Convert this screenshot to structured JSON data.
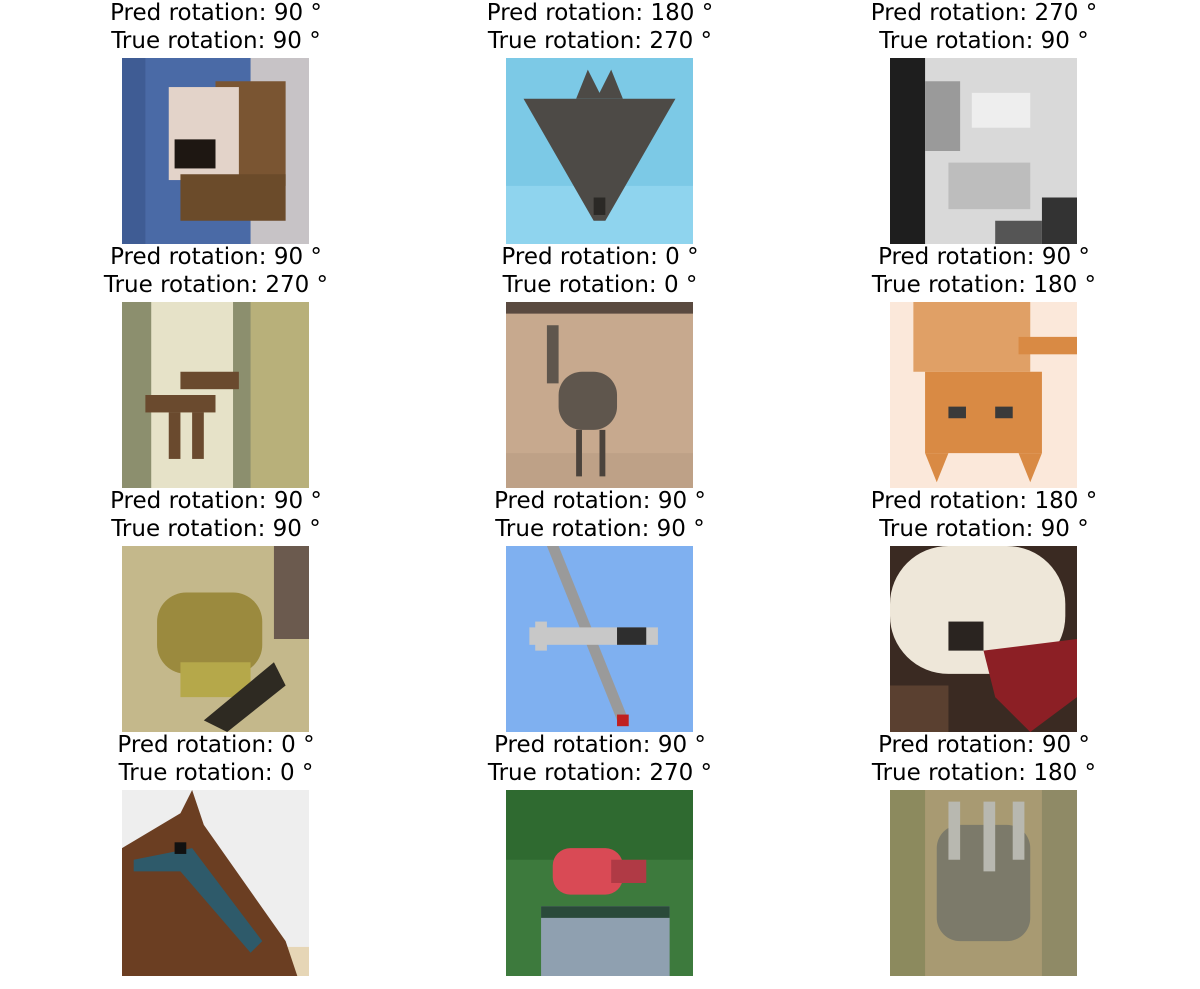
{
  "panels": [
    {
      "pred": "Pred rotation: 90$^\\circ$",
      "true": "True rotation: 90$^\\circ$",
      "pred_text": "Pred rotation: 90 °",
      "true_text": "True rotation: 90 °",
      "subject": "dog-rotated",
      "colors": [
        "#4a6aa6",
        "#c9b8a6",
        "#6b4b2a"
      ]
    },
    {
      "pred_text": "Pred rotation: 180 °",
      "true_text": "True rotation: 270 °",
      "subject": "airplane-stealth",
      "colors": [
        "#7cc9e6",
        "#4d4a46"
      ]
    },
    {
      "pred_text": "Pred rotation: 270 °",
      "true_text": "True rotation: 90 °",
      "subject": "cat-grayscale",
      "colors": [
        "#1e1e1e",
        "#d9d9d9"
      ]
    },
    {
      "pred_text": "Pred rotation: 90 °",
      "true_text": "True rotation: 270 °",
      "subject": "deer-rotated",
      "colors": [
        "#8c8f6e",
        "#e6e2c8",
        "#6a4a2e"
      ]
    },
    {
      "pred_text": "Pred rotation: 0 °",
      "true_text": "True rotation: 0 °",
      "subject": "ostrich",
      "colors": [
        "#c7a98e",
        "#5f564d"
      ]
    },
    {
      "pred_text": "Pred rotation: 90 °",
      "true_text": "True rotation: 180 °",
      "subject": "cat-upside-down",
      "colors": [
        "#fbe8da",
        "#d98a44"
      ]
    },
    {
      "pred_text": "Pred rotation: 90 °",
      "true_text": "True rotation: 90 °",
      "subject": "frog-rotated",
      "colors": [
        "#c4b88b",
        "#9b8a3e",
        "#2e2a22"
      ]
    },
    {
      "pred_text": "Pred rotation: 90 °",
      "true_text": "True rotation: 90 °",
      "subject": "airplane-propeller",
      "colors": [
        "#7fb0f0",
        "#c8c8c8"
      ]
    },
    {
      "pred_text": "Pred rotation: 180 °",
      "true_text": "True rotation: 90 °",
      "subject": "dog-fluffy",
      "colors": [
        "#3a2a22",
        "#eee7d9",
        "#8c1f25"
      ]
    },
    {
      "pred_text": "Pred rotation: 0 °",
      "true_text": "True rotation: 0 °",
      "subject": "horse-head",
      "colors": [
        "#eeeeee",
        "#6b3e22",
        "#2e5a6a"
      ]
    },
    {
      "pred_text": "Pred rotation: 90 °",
      "true_text": "True rotation: 270 °",
      "subject": "bird-red",
      "colors": [
        "#3d7a3d",
        "#d94a55",
        "#8fa0b0"
      ]
    },
    {
      "pred_text": "Pred rotation: 90 °",
      "true_text": "True rotation: 180 °",
      "subject": "rodent-grass",
      "colors": [
        "#a89a72",
        "#7c7a6a"
      ]
    }
  ]
}
